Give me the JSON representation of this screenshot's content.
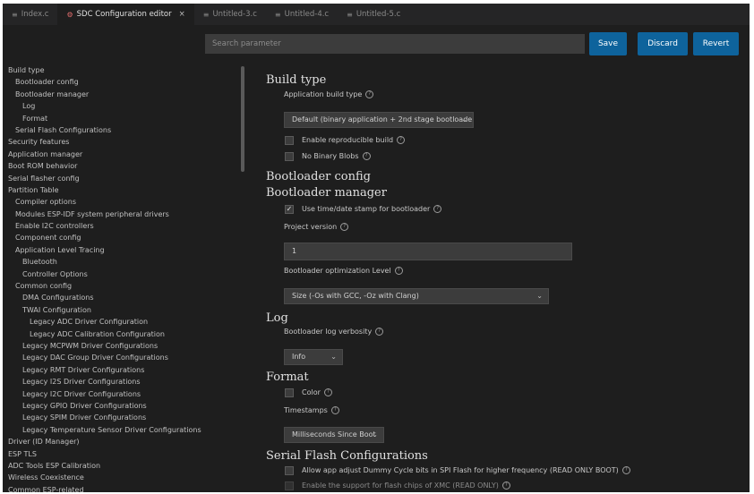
{
  "tabs": [
    {
      "icon": "≡",
      "label": "Index.c",
      "active": false
    },
    {
      "icon": "⚙",
      "label": "SDC Configuration editor",
      "active": true,
      "close": "×"
    },
    {
      "icon": "≡",
      "label": "Untitled-3.c",
      "active": false
    },
    {
      "icon": "≡",
      "label": "Untitled-4.c",
      "active": false
    },
    {
      "icon": "≡",
      "label": "Untitled-5.c",
      "active": false
    }
  ],
  "toolbar": {
    "search_placeholder": "Search parameter",
    "save_label": "Save",
    "discard_label": "Discard",
    "revert_label": "Revert"
  },
  "tree": [
    "Build type",
    "  Bootloader config",
    "  Bootloader manager",
    "    Log",
    "    Format",
    "  Serial Flash Configurations",
    "Security features",
    "Application manager",
    "Boot ROM behavior",
    "Serial flasher config",
    "Partition Table",
    "  Compiler options",
    "  Modules ESP-IDF system peripheral drivers",
    "  Enable I2C controllers",
    "  Component config",
    "  Application Level Tracing",
    "    Bluetooth",
    "    Controller Options",
    "  Common config",
    "    DMA Configurations",
    "    TWAI Configuration",
    "      Legacy ADC Driver Configuration",
    "      Legacy ADC Calibration Configuration",
    "    Legacy MCPWM Driver Configurations",
    "    Legacy DAC Group Driver Configurations",
    "    Legacy RMT Driver Configurations",
    "    Legacy I2S Driver Configurations",
    "    Legacy I2C Driver Configurations",
    "    Legacy GPIO Driver Configurations",
    "    Legacy SPIM Driver Configurations",
    "    Legacy Temperature Sensor Driver Configurations",
    "Driver (ID Manager)",
    "ESP TLS",
    "ADC Tools ESP Calibration",
    "Wireless Coexistence",
    "Common ESP-related"
  ],
  "settings": {
    "build_type": {
      "title": "Build type",
      "app_build_type_label": "Application build type",
      "app_build_type_value": "Default (binary application + 2nd stage bootloader)",
      "build_raw_label": "Enable reproducible build",
      "no_binary_label": "No Binary Blobs",
      "build_raw_checked": false,
      "no_binary_checked": false
    },
    "bootloader_config": {
      "title": "Bootloader config"
    },
    "bootloader_manager": {
      "title": "Bootloader manager",
      "use_timestamp_label": "Use time/date stamp for bootloader",
      "use_timestamp_checked": true,
      "project_version_label": "Project version",
      "project_version_value": "1",
      "optimization_label": "Bootloader optimization Level",
      "optimization_value": "Size (-Os with GCC, -Oz with Clang)"
    },
    "log": {
      "title": "Log",
      "verbosity_label": "Bootloader log verbosity",
      "verbosity_value": "Info"
    },
    "format": {
      "title": "Format",
      "color_label": "Color",
      "color_checked": false,
      "timestamps_label": "Timestamps",
      "timestamps_value": "Milliseconds Since Boot"
    },
    "serial_flash": {
      "title": "Serial Flash Configurations",
      "item1_label": "Allow app adjust Dummy Cycle bits in SPI Flash for higher frequency (READ ONLY BOOT)",
      "item2_label": "Enable the support for flash chips of XMC (READ ONLY)"
    }
  }
}
